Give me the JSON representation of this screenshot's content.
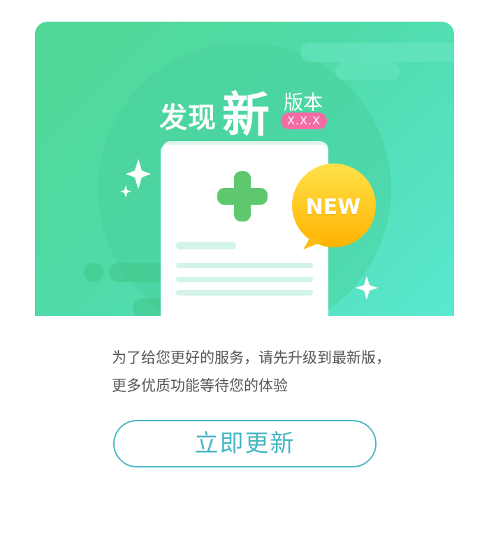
{
  "banner": {
    "title_prefix": "发现",
    "title_emphasis": "新",
    "title_suffix": "版本",
    "version": "X.X.X",
    "new_badge": "NEW",
    "icons": [
      "plus-icon",
      "sparkle-icon",
      "speech-bubble-icon",
      "document-icon"
    ],
    "colors": {
      "gradient_start": "#52d896",
      "gradient_end": "#5ae8d2",
      "badge_pink": "#f46ca5",
      "new_bubble": "#ffc21a",
      "plus_green": "#5dc86e"
    }
  },
  "message": {
    "line1": "为了给您更好的服务，请先升级到最新版，",
    "line2": "更多优质功能等待您的体验"
  },
  "update_button": {
    "label": "立即更新",
    "accent": "#49b7c3"
  }
}
